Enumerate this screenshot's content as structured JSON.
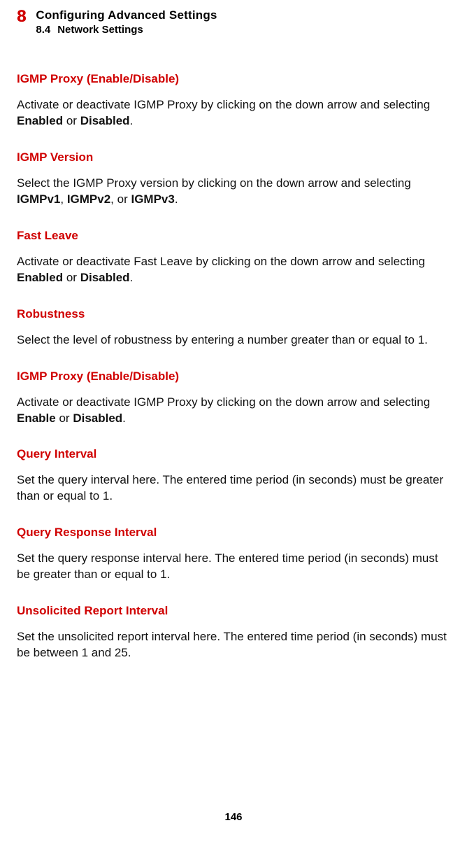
{
  "header": {
    "chapter_number": "8",
    "chapter_title": "Configuring Advanced Settings",
    "subsection_number": "8.4",
    "subsection_title": "Network Settings"
  },
  "sections": [
    {
      "heading": "IGMP Proxy (Enable/Disable)",
      "body_parts": [
        {
          "text": "Activate or deactivate IGMP Proxy by clicking on the down arrow and selecting ",
          "bold": false
        },
        {
          "text": "Enabled",
          "bold": true
        },
        {
          "text": " or ",
          "bold": false
        },
        {
          "text": "Disabled",
          "bold": true
        },
        {
          "text": ".",
          "bold": false
        }
      ]
    },
    {
      "heading": "IGMP Version",
      "body_parts": [
        {
          "text": "Select the IGMP Proxy version by clicking on the down arrow and selecting ",
          "bold": false
        },
        {
          "text": "IGMPv1",
          "bold": true
        },
        {
          "text": ", ",
          "bold": false
        },
        {
          "text": "IGMPv2",
          "bold": true
        },
        {
          "text": ", or ",
          "bold": false
        },
        {
          "text": "IGMPv3",
          "bold": true
        },
        {
          "text": ".",
          "bold": false
        }
      ]
    },
    {
      "heading": "Fast Leave",
      "body_parts": [
        {
          "text": "Activate or deactivate Fast Leave by clicking on the down arrow and selecting ",
          "bold": false
        },
        {
          "text": "Enabled",
          "bold": true
        },
        {
          "text": " or ",
          "bold": false
        },
        {
          "text": "Disabled",
          "bold": true
        },
        {
          "text": ".",
          "bold": false
        }
      ]
    },
    {
      "heading": "Robustness",
      "body_parts": [
        {
          "text": "Select the level of robustness by entering a number greater than or equal to 1.",
          "bold": false
        }
      ]
    },
    {
      "heading": "IGMP Proxy (Enable/Disable)",
      "body_parts": [
        {
          "text": "Activate or deactivate IGMP Proxy by clicking on the down arrow and selecting ",
          "bold": false
        },
        {
          "text": "Enable",
          "bold": true
        },
        {
          "text": " or ",
          "bold": false
        },
        {
          "text": "Disabled",
          "bold": true
        },
        {
          "text": ".",
          "bold": false
        }
      ]
    },
    {
      "heading": "Query Interval",
      "body_parts": [
        {
          "text": "Set the query interval here. The entered time period (in seconds) must be greater than or equal to 1.",
          "bold": false
        }
      ]
    },
    {
      "heading": "Query Response Interval",
      "body_parts": [
        {
          "text": "Set the query response interval here. The entered time period (in seconds) must be greater than or equal to 1.",
          "bold": false
        }
      ]
    },
    {
      "heading": "Unsolicited Report Interval",
      "body_parts": [
        {
          "text": "Set the unsolicited report interval here. The entered time period (in seconds) must be between 1 and 25.",
          "bold": false
        }
      ]
    }
  ],
  "page_number": "146"
}
